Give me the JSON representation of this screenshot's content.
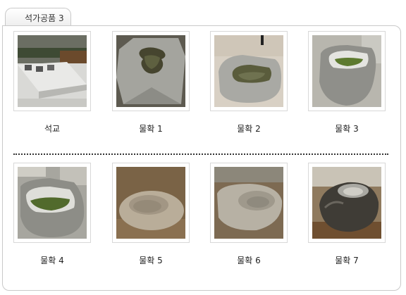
{
  "tab": {
    "label": "석가공품 3"
  },
  "gallery": {
    "items": [
      {
        "caption": "석교",
        "icon": "stone-bridge-photo"
      },
      {
        "caption": "물확 1",
        "icon": "stone-basin-photo"
      },
      {
        "caption": "물확 2",
        "icon": "stone-basin-photo"
      },
      {
        "caption": "물확 3",
        "icon": "stone-basin-photo"
      },
      {
        "caption": "물확 4",
        "icon": "stone-basin-photo"
      },
      {
        "caption": "물확 5",
        "icon": "stone-basin-photo"
      },
      {
        "caption": "물확 6",
        "icon": "stone-basin-photo"
      },
      {
        "caption": "물확 7",
        "icon": "stone-basin-photo"
      }
    ]
  },
  "colors": {
    "border": "#c9c9c9",
    "stone": "#9a9a96",
    "water": "#5d6b3b",
    "ground": "#8a7050"
  }
}
